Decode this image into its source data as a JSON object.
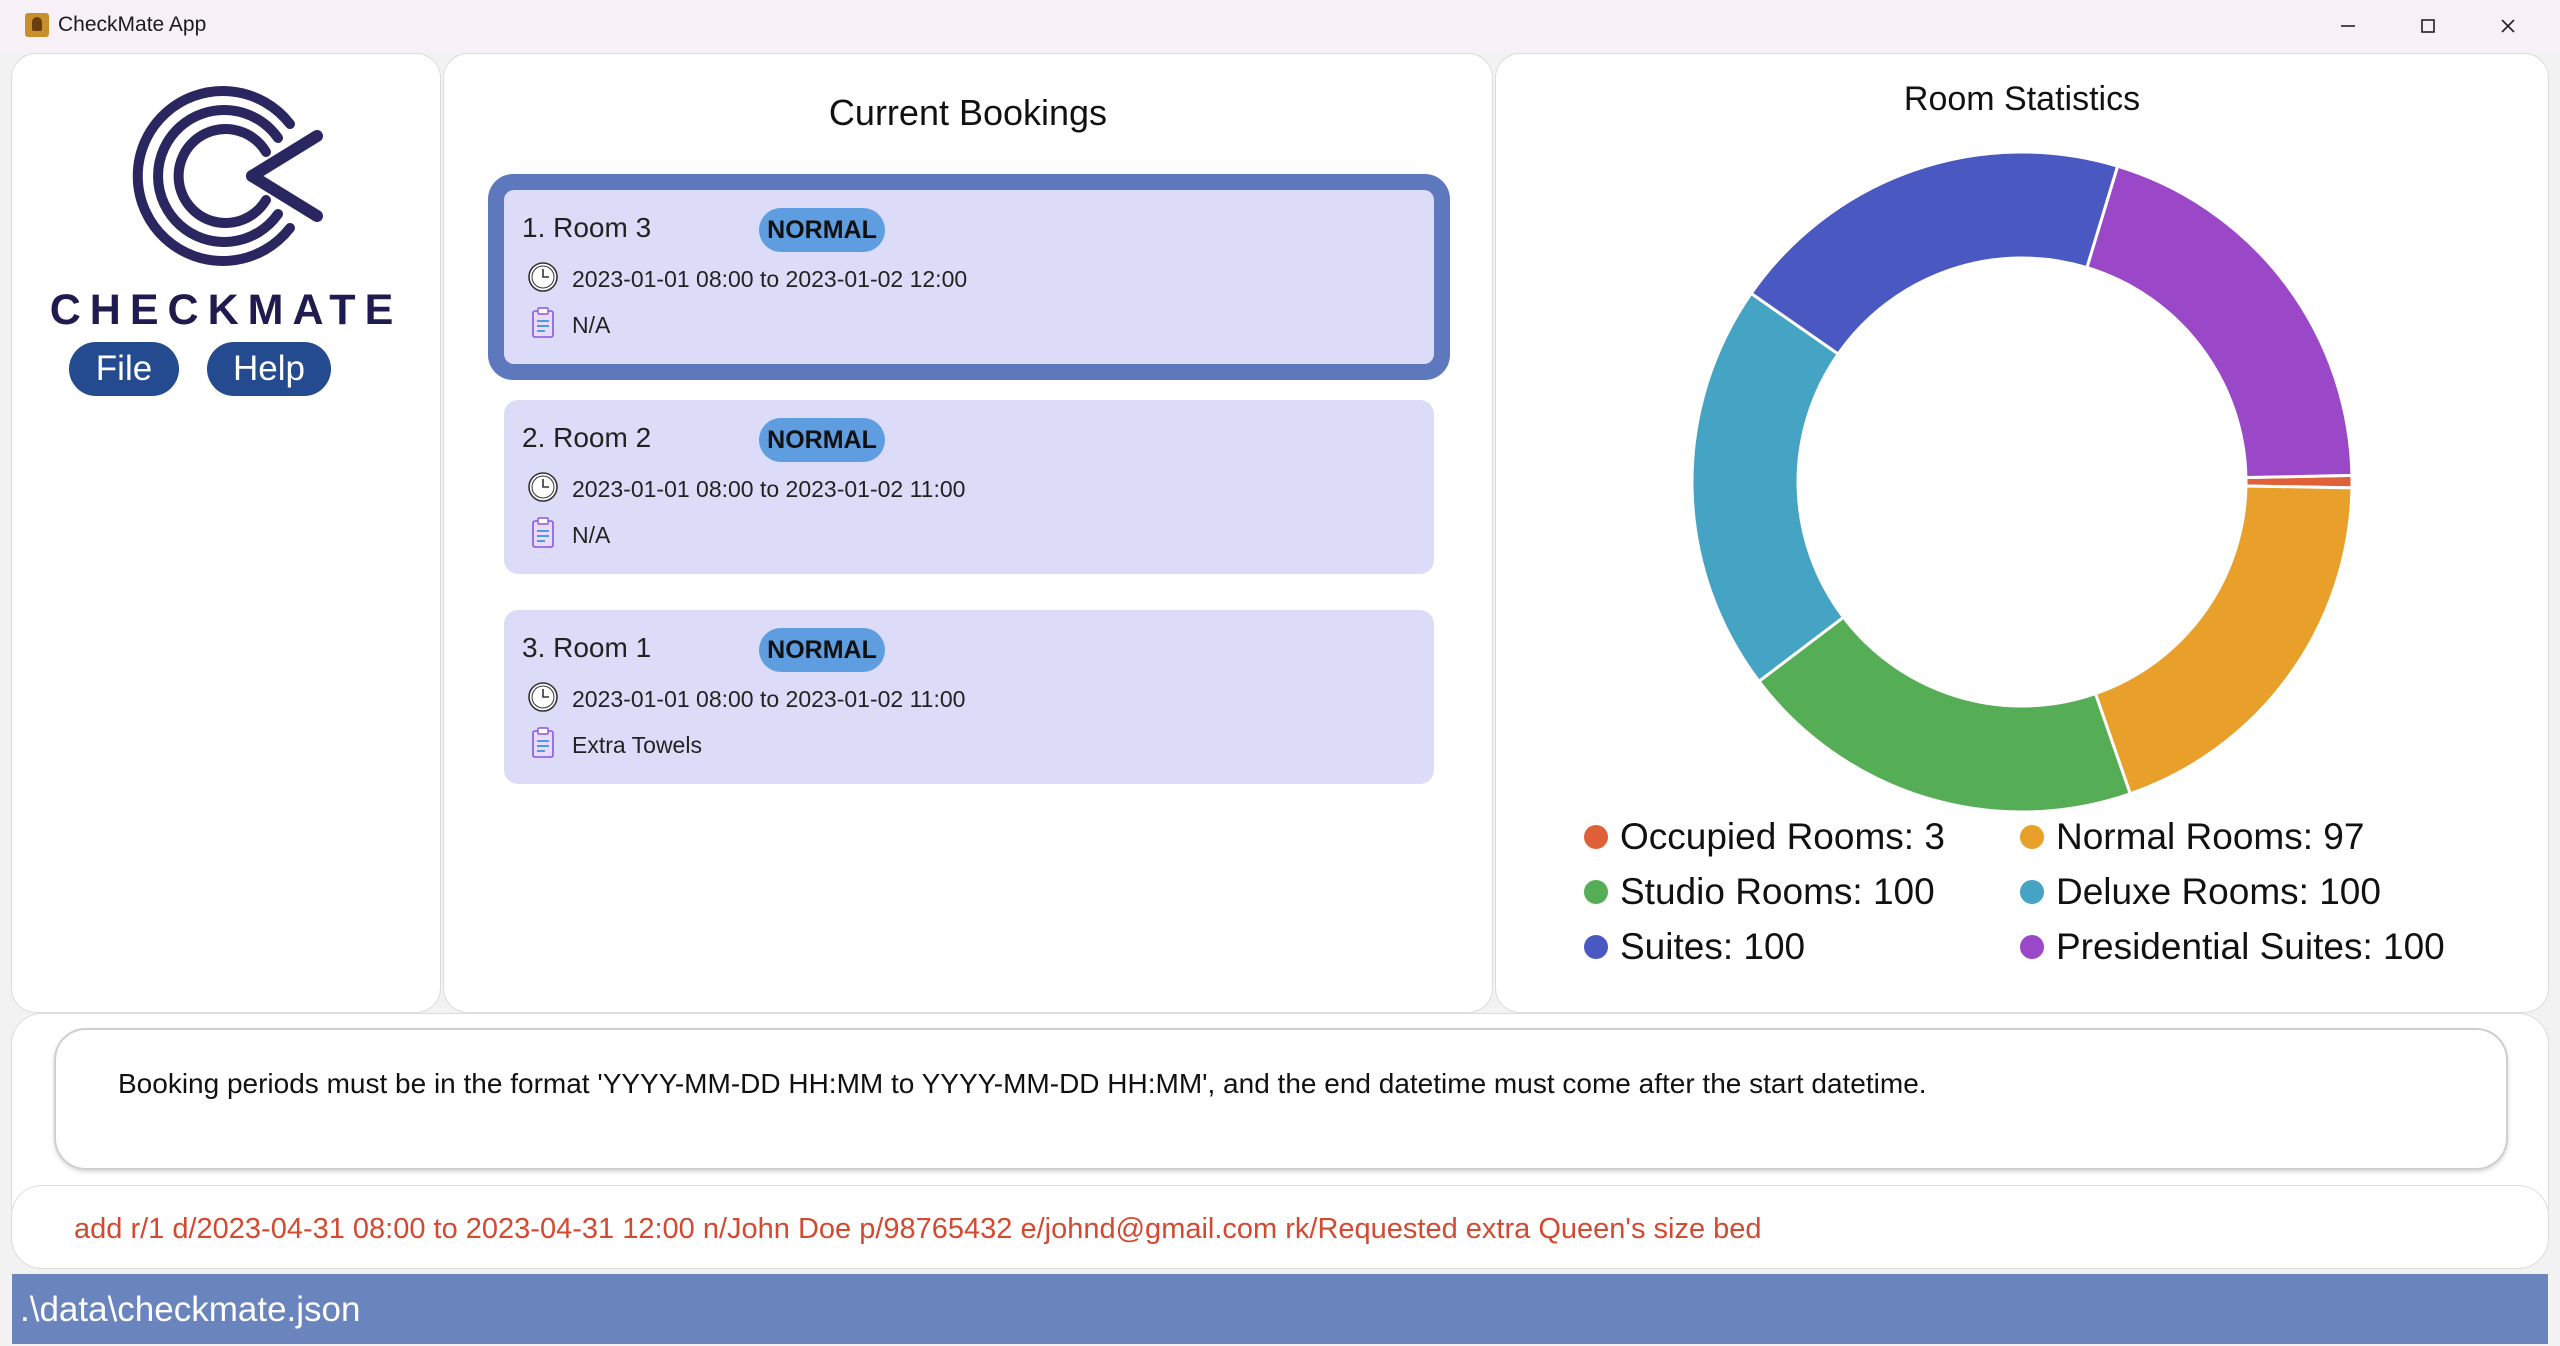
{
  "window": {
    "title": "CheckMate App",
    "controls": {
      "minimize": "—",
      "maximize": "☐",
      "close": "✕"
    }
  },
  "sidebar": {
    "logo_text": "CHECKMATE",
    "menu": {
      "file": "File",
      "help": "Help"
    }
  },
  "bookings": {
    "title": "Current Bookings",
    "items": [
      {
        "title": "1.  Room 3",
        "badge": "NORMAL",
        "period": "2023-01-01 08:00 to 2023-01-02 12:00",
        "remark": "N/A",
        "selected": true
      },
      {
        "title": "2.  Room 2",
        "badge": "NORMAL",
        "period": "2023-01-01 08:00 to 2023-01-02 11:00",
        "remark": "N/A",
        "selected": false
      },
      {
        "title": "3.  Room 1",
        "badge": "NORMAL",
        "period": "2023-01-01 08:00 to 2023-01-02 11:00",
        "remark": "Extra Towels",
        "selected": false
      }
    ]
  },
  "stats": {
    "title": "Room Statistics",
    "legend": [
      {
        "label": "Occupied Rooms: 3",
        "color": "#e0603a"
      },
      {
        "label": "Normal Rooms: 97",
        "color": "#e9a02a"
      },
      {
        "label": "Studio Rooms: 100",
        "color": "#55ad55"
      },
      {
        "label": "Deluxe Rooms: 100",
        "color": "#45a3c4"
      },
      {
        "label": "Suites: 100",
        "color": "#4a58c2"
      },
      {
        "label": "Presidential Suites: 100",
        "color": "#9a48c8"
      }
    ]
  },
  "chart_data": {
    "type": "pie",
    "title": "Room Statistics",
    "categories": [
      "Occupied Rooms",
      "Normal Rooms",
      "Studio Rooms",
      "Deluxe Rooms",
      "Suites",
      "Presidential Suites"
    ],
    "values": [
      3,
      97,
      100,
      100,
      100,
      100
    ],
    "colors": [
      "#e0603a",
      "#e9a02a",
      "#55ad55",
      "#45a3c4",
      "#4a58c2",
      "#9a48c8"
    ],
    "donut": true,
    "legend_position": "bottom"
  },
  "result": {
    "message": "Booking periods must be in the format 'YYYY-MM-DD HH:MM to YYYY-MM-DD HH:MM', and the end datetime must come after the start datetime."
  },
  "command": {
    "value": "add r/1 d/2023-04-31 08:00 to 2023-04-31 12:00 n/John Doe p/98765432 e/johnd@gmail.com rk/Requested extra Queen's size bed"
  },
  "status_bar": {
    "path": ".\\data\\checkmate.json"
  },
  "icons": {
    "booking_period": "clock-icon",
    "booking_remark": "clipboard-icon"
  }
}
